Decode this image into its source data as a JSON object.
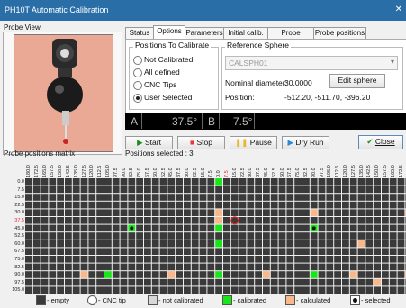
{
  "window": {
    "title": "PH10T  Automatic Calibration",
    "close_glyph": "✕"
  },
  "probe_view": {
    "label": "Probe View"
  },
  "tabs": [
    "Status",
    "Options",
    "Parameters",
    "Initial calib.",
    "Probe settings",
    "Probe positions"
  ],
  "active_tab": "Options",
  "positions_group": {
    "title": "Positions To Calibrate",
    "options": [
      {
        "label": "Not Calibrated",
        "selected": false
      },
      {
        "label": "All defined",
        "selected": false
      },
      {
        "label": "CNC Tips",
        "selected": false
      },
      {
        "label": "User Selected",
        "selected": true
      }
    ]
  },
  "sphere_group": {
    "title": "Reference Sphere",
    "sphere_select": "CALSPH01",
    "nominal_label": "Nominal diameter:",
    "nominal_value": "30.0000",
    "edit_button": "Edit sphere",
    "position_label": "Position:",
    "position_value": "-512.20, -511.70, -396.20"
  },
  "angles": {
    "a_label": "A",
    "a_value": "37.5°",
    "b_label": "B",
    "b_value": "7.5°"
  },
  "controls": {
    "start": "Start",
    "stop": "Stop",
    "pause": "Pause",
    "dry_run": "Dry Run",
    "close": "Close"
  },
  "matrix": {
    "title": "Probe positions matrix",
    "selected_text": "Positions selected : 3",
    "columns": [
      "180.0",
      "172.5",
      "165.0",
      "157.5",
      "150.0",
      "142.5",
      "135.0",
      "127.5",
      "120.0",
      "112.5",
      "105.0",
      "97.5",
      "90.0",
      "82.5",
      "75.0",
      "67.5",
      "60.0",
      "52.5",
      "45.0",
      "37.5",
      "30.0",
      "22.5",
      "15.0",
      "7.5",
      "0.0",
      "7.5",
      "15.0",
      "22.5",
      "30.0",
      "37.5",
      "45.0",
      "52.5",
      "60.0",
      "67.5",
      "75.0",
      "82.5",
      "90.0",
      "97.5",
      "105.0",
      "112.5",
      "120.0",
      "127.5",
      "135.0",
      "142.5",
      "150.0",
      "157.5",
      "165.0",
      "172.5",
      "180.0"
    ],
    "rows": [
      "0.0",
      "7.5",
      "15.0",
      "22.5",
      "30.0",
      "37.5",
      "45.0",
      "52.5",
      "60.0",
      "67.5",
      "75.0",
      "82.5",
      "90.0",
      "97.5",
      "105.0"
    ],
    "highlight_row": "37.5",
    "highlight_col": "7.5",
    "calibrated": [
      [
        0,
        24
      ],
      [
        6,
        13
      ],
      [
        6,
        24
      ],
      [
        6,
        36
      ],
      [
        8,
        24
      ],
      [
        12,
        10
      ],
      [
        12,
        24
      ],
      [
        12,
        36
      ]
    ],
    "calculated": [
      [
        4,
        24
      ],
      [
        4,
        36
      ],
      [
        4,
        48
      ],
      [
        5,
        24
      ],
      [
        8,
        42
      ],
      [
        12,
        7
      ],
      [
        12,
        18
      ],
      [
        12,
        30
      ],
      [
        12,
        41
      ],
      [
        12,
        48
      ],
      [
        13,
        44
      ]
    ],
    "selected": [
      [
        6,
        13
      ],
      [
        6,
        36
      ]
    ],
    "cnc_tip": [
      [
        5,
        26
      ]
    ]
  },
  "legend": [
    {
      "label": "- empty",
      "color": "#3a3a3a"
    },
    {
      "label": "- CNC tip",
      "color": "#ffffff"
    },
    {
      "label": "- not calibrated",
      "color": "#d8d8d8"
    },
    {
      "label": "- calibrated",
      "color": "#19e619"
    },
    {
      "label": "- calculated",
      "color": "#f8b88a"
    },
    {
      "label": "- selected",
      "color": "#ffffff"
    }
  ],
  "colors": {
    "empty": "#3a3a3a",
    "calibrated": "#19e619",
    "calculated": "#f8b88a",
    "highlight": "#e22",
    "title_bar": "#2a6ea8"
  }
}
